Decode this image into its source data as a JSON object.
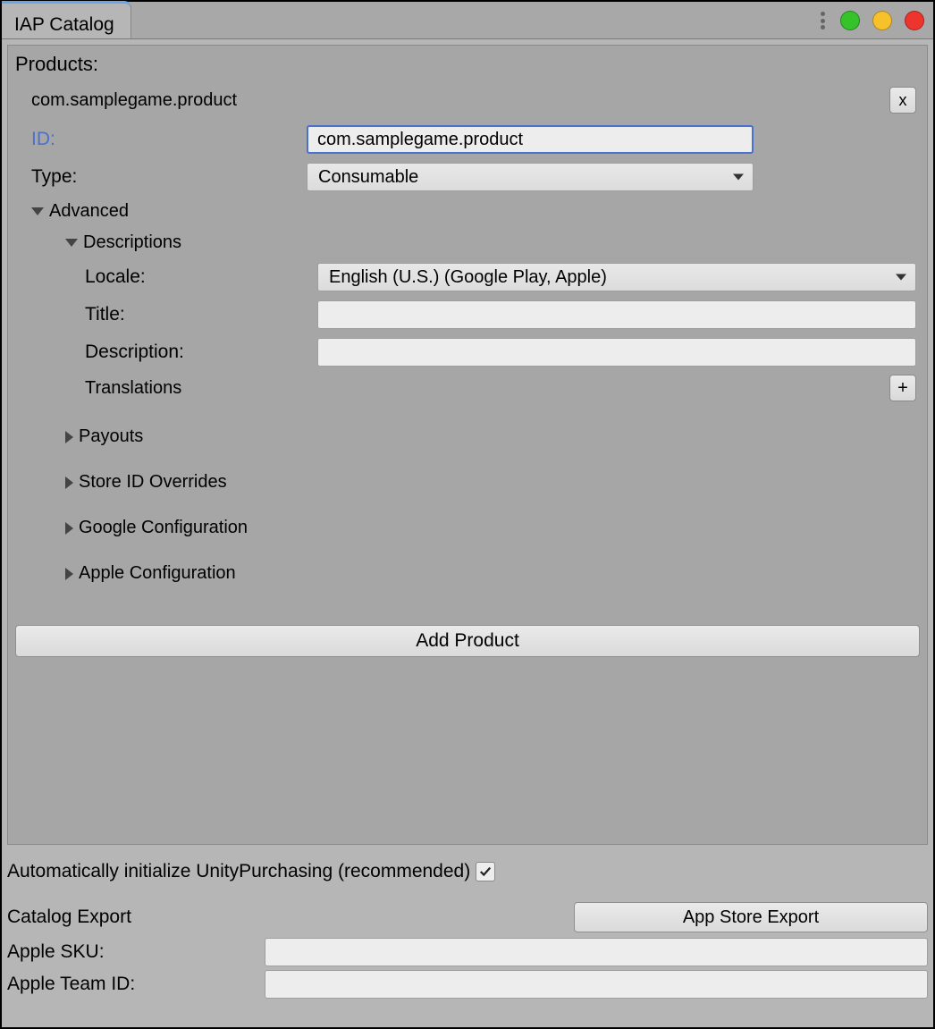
{
  "tab": {
    "title": "IAP Catalog"
  },
  "products": {
    "section_label": "Products:",
    "item": {
      "name": "com.samplegame.product",
      "remove_label": "x",
      "fields": {
        "id_label": "ID:",
        "id_value": "com.samplegame.product",
        "type_label": "Type:",
        "type_value": "Consumable"
      },
      "advanced": {
        "label": "Advanced",
        "descriptions": {
          "label": "Descriptions",
          "locale_label": "Locale:",
          "locale_value": "English (U.S.) (Google Play, Apple)",
          "title_label": "Title:",
          "title_value": "",
          "description_label": "Description:",
          "description_value": "",
          "translations_label": "Translations",
          "add_translation_label": "+"
        },
        "payouts_label": "Payouts",
        "store_overrides_label": "Store ID Overrides",
        "google_config_label": "Google Configuration",
        "apple_config_label": "Apple Configuration"
      }
    },
    "add_product_label": "Add Product"
  },
  "footer": {
    "auto_init_label": "Automatically initialize UnityPurchasing (recommended)",
    "auto_init_checked": true,
    "catalog_export_label": "Catalog Export",
    "app_store_export_label": "App Store Export",
    "apple_sku_label": "Apple SKU:",
    "apple_sku_value": "",
    "apple_team_id_label": "Apple Team ID:",
    "apple_team_id_value": ""
  }
}
